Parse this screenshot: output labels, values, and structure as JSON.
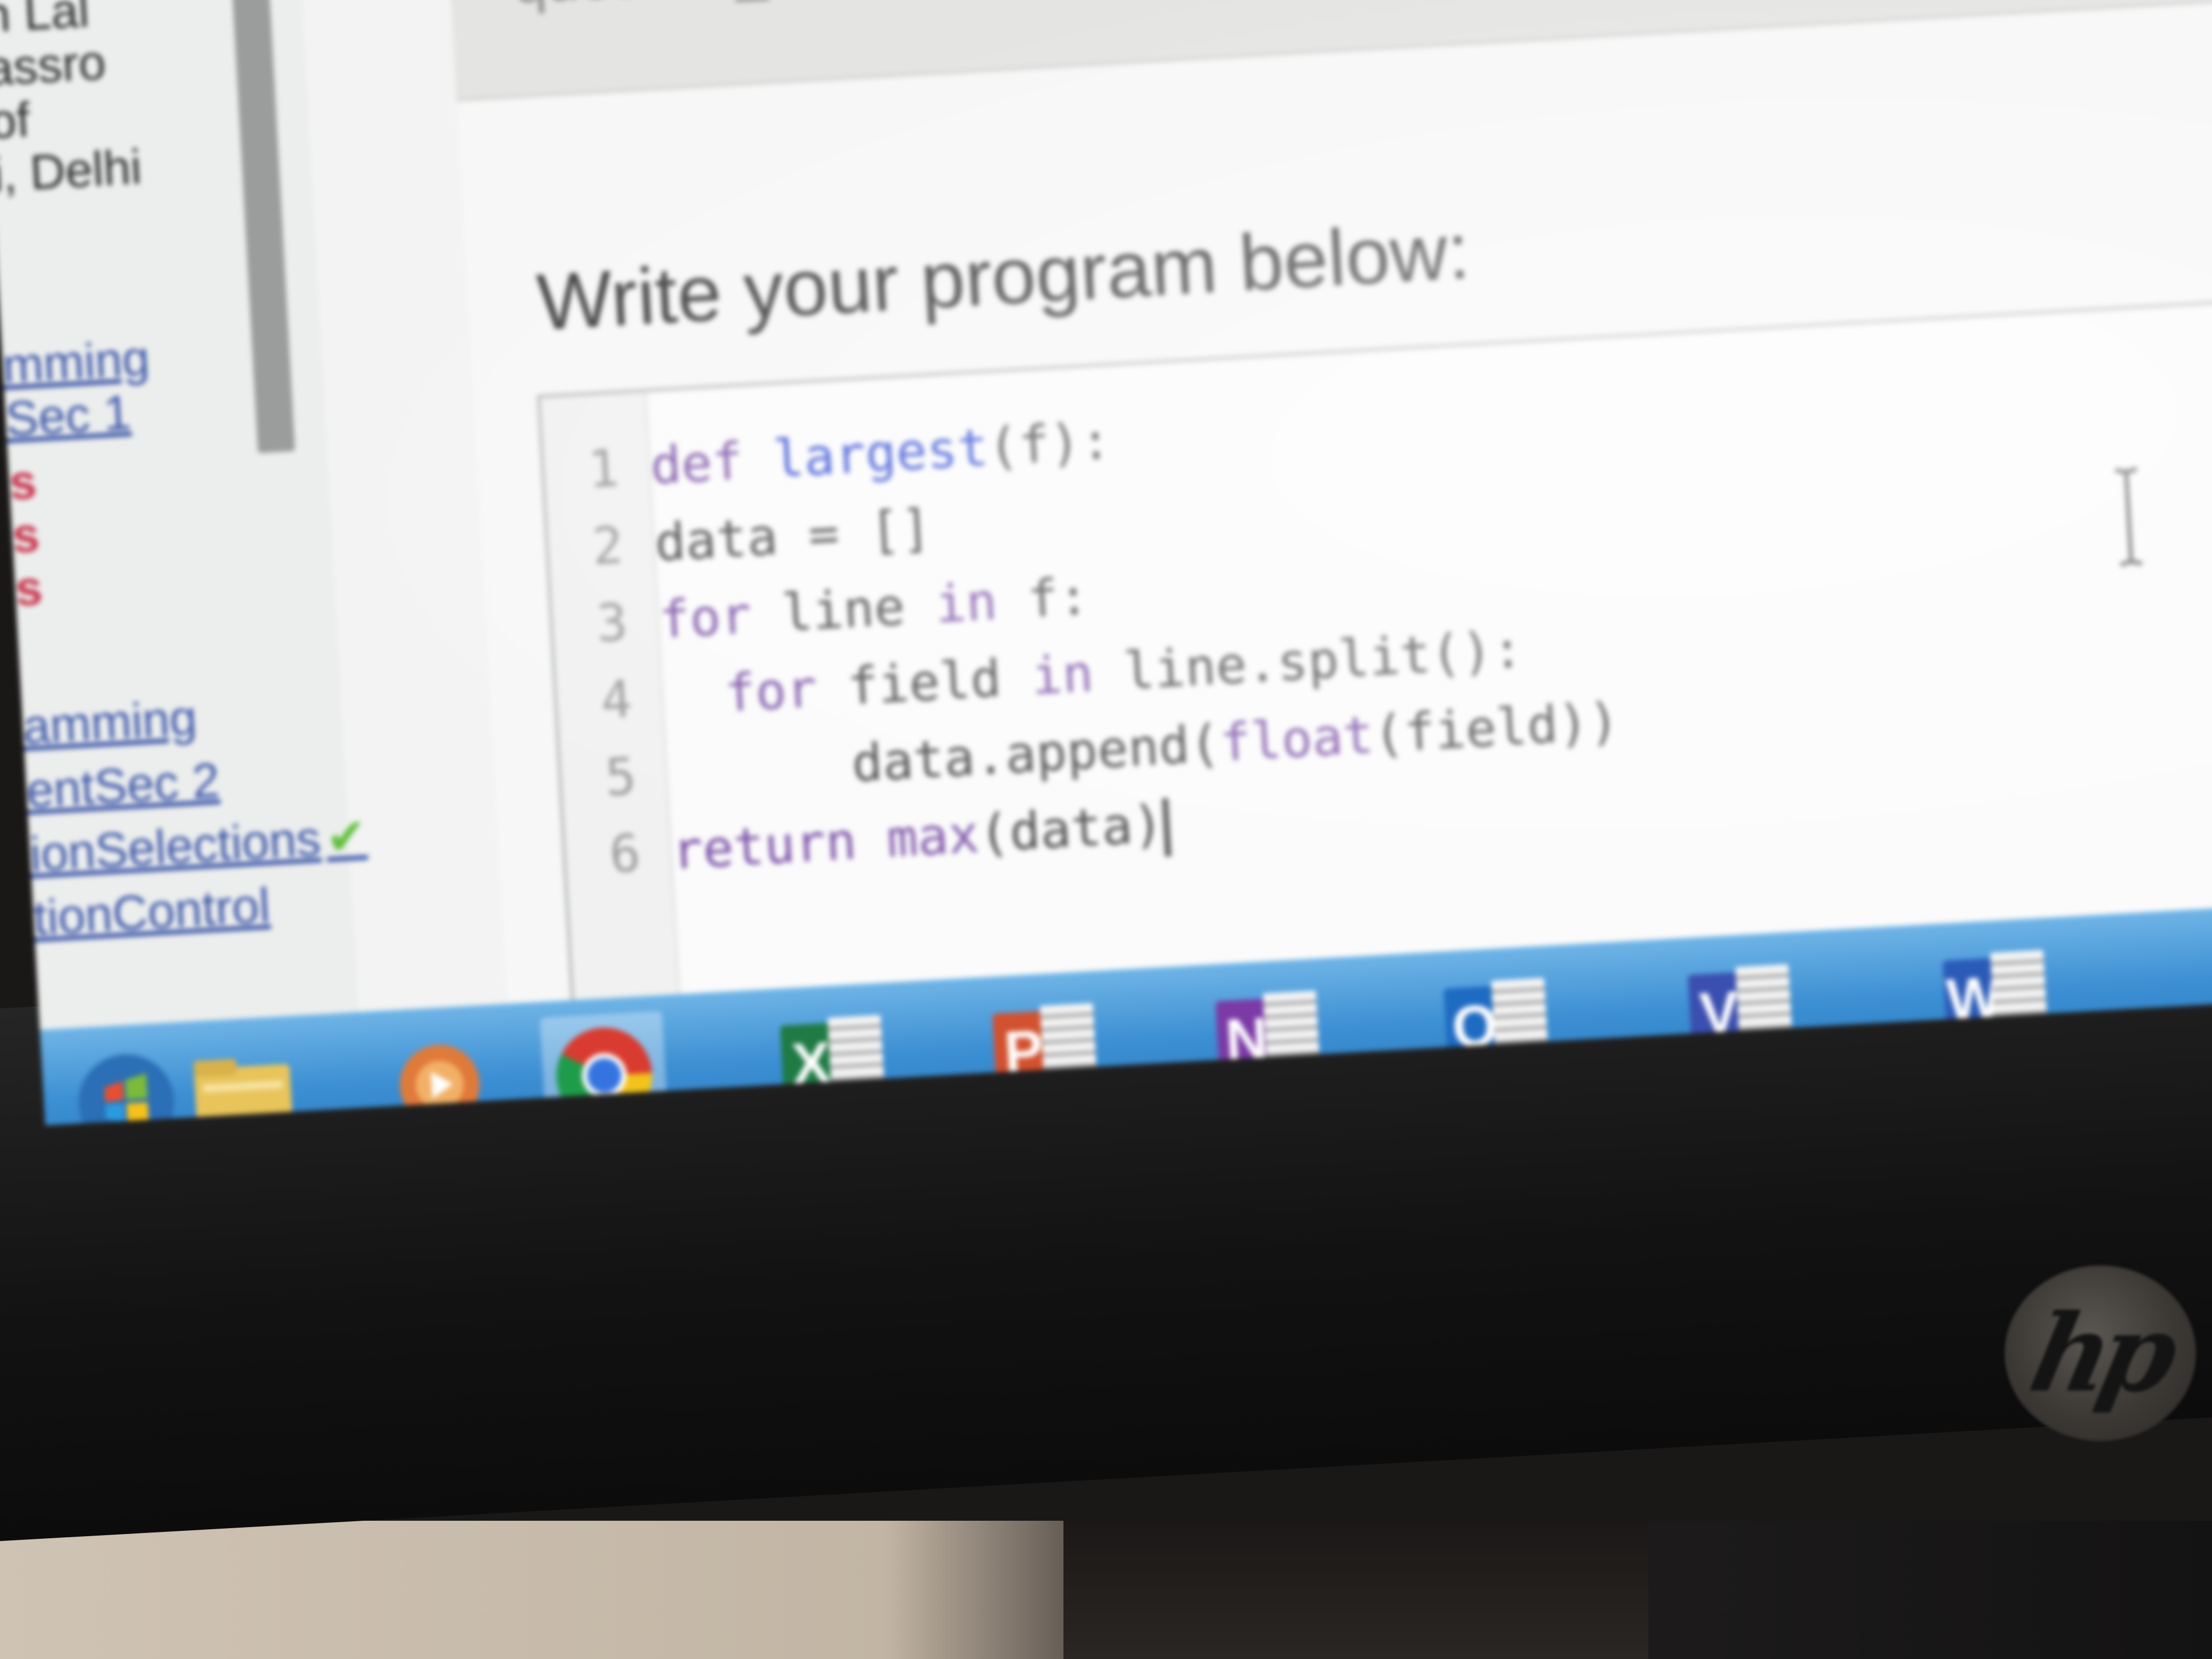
{
  "colors": {
    "taskbar": "#3c8fd3",
    "code_keyword": "#7a4fa6",
    "code_function": "#2f4bd3",
    "excel": "#1f7a44",
    "powerpoint": "#d2512f",
    "onenote": "#7b3aa6",
    "outlook": "#1e6bc2",
    "visio": "#3a4fb0",
    "word": "#2b5bb8"
  },
  "sidebar": {
    "items": [
      {
        "label": "mming"
      },
      {
        "label": "n Lal"
      },
      {
        "label": "assro"
      },
      {
        "label": "of"
      },
      {
        "label": "i, Delhi"
      },
      {
        "label": "mming"
      },
      {
        "label": "Sec 1"
      },
      {
        "label": "s"
      },
      {
        "label": "s"
      },
      {
        "label": "s"
      },
      {
        "label": "amming"
      },
      {
        "label": "entSec 2"
      },
      {
        "label": "ionSelections"
      },
      {
        "label": "tionControl"
      }
    ]
  },
  "header": {
    "text": "question_"
  },
  "main": {
    "prompt": "Write your program below:"
  },
  "editor": {
    "lines": [
      {
        "num": "1",
        "indent": "",
        "parts": [
          {
            "t": "def ",
            "c": "kw"
          },
          {
            "t": "largest",
            "c": "fn"
          },
          {
            "t": "(f):",
            "c": "code"
          }
        ]
      },
      {
        "num": "2",
        "indent": "",
        "parts": [
          {
            "t": "data = []",
            "c": "code"
          }
        ]
      },
      {
        "num": "3",
        "indent": "",
        "parts": [
          {
            "t": "for ",
            "c": "kw"
          },
          {
            "t": "line ",
            "c": "code"
          },
          {
            "t": "in ",
            "c": "kw"
          },
          {
            "t": "f:",
            "c": "code"
          }
        ]
      },
      {
        "num": "4",
        "indent": "  ",
        "parts": [
          {
            "t": "for ",
            "c": "kw"
          },
          {
            "t": "field ",
            "c": "code"
          },
          {
            "t": "in ",
            "c": "kw"
          },
          {
            "t": "line.split():",
            "c": "code"
          }
        ]
      },
      {
        "num": "5",
        "indent": "      ",
        "parts": [
          {
            "t": "data.append(",
            "c": "code"
          },
          {
            "t": "float",
            "c": "kw"
          },
          {
            "t": "(field))",
            "c": "code"
          }
        ]
      },
      {
        "num": "6",
        "indent": "",
        "parts": [
          {
            "t": "return ",
            "c": "kw"
          },
          {
            "t": "max",
            "c": "kw"
          },
          {
            "t": "(data)",
            "c": "code"
          }
        ]
      }
    ]
  },
  "taskbar": {
    "apps": [
      {
        "name": "start",
        "icon": "windows-orb-icon"
      },
      {
        "name": "explorer",
        "icon": "folder-icon"
      },
      {
        "name": "media",
        "icon": "media-player-icon"
      },
      {
        "name": "chrome",
        "icon": "chrome-icon"
      },
      {
        "name": "excel",
        "icon": "excel-icon",
        "letter": "X"
      },
      {
        "name": "powerpoint",
        "icon": "powerpoint-icon",
        "letter": "P"
      },
      {
        "name": "onenote",
        "icon": "onenote-icon",
        "letter": "N"
      },
      {
        "name": "outlook",
        "icon": "outlook-icon",
        "letter": "O"
      },
      {
        "name": "visio",
        "icon": "visio-icon",
        "letter": "V"
      },
      {
        "name": "word",
        "icon": "word-icon",
        "letter": "W"
      }
    ]
  },
  "monitor": {
    "brand": "hp"
  }
}
